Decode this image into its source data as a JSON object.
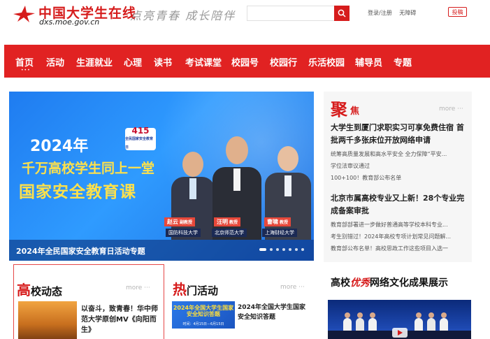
{
  "header": {
    "site_name": "中国大学生在线",
    "domain": "dxs.moe.gov.cn",
    "slogan": "点亮青春 成长陪伴",
    "search_placeholder": "",
    "links": [
      "登录/注册",
      "无障碍"
    ],
    "submit_label": "投稿",
    "icons": [
      "logo-star-icon",
      "search-icon"
    ],
    "brand_color": "#d61c1c"
  },
  "nav": {
    "items": [
      "首页",
      "活动",
      "生涯就业",
      "心理",
      "读书",
      "考试课堂",
      "校园号",
      "校园行",
      "乐活校园",
      "辅导员",
      "专题"
    ],
    "active_index": 0,
    "active_marker": "•••",
    "color": "#e12222"
  },
  "banner": {
    "year": "2024年",
    "line1": "千万高校学生同上一堂",
    "line2": "国家安全教育课",
    "badge_number": "415",
    "badge_sub": "全民国家安全教育日",
    "speakers": [
      {
        "name": "赵云",
        "title": "副教授",
        "university": "国防科技大学"
      },
      {
        "name": "汪明",
        "title": "教授",
        "university": "北京师范大学"
      },
      {
        "name": "曹啸",
        "title": "教授",
        "university": "上海财经大学"
      }
    ],
    "caption": "2024年全民国家安全教育日活动专题",
    "slide_count": 7,
    "active_slide": 0
  },
  "focus": {
    "title_big": "聚",
    "title_small": "焦",
    "more_label": "more ···",
    "headline1": "大学生到厦门求职实习可享免费住宿 首批两千多张床位开放网络申请",
    "items1": [
      "统筹高质量发展和高水平安全 全力保障“平安...",
      "学位法审议通过",
      "100+100！教育部公布名单"
    ],
    "headline2": "北京市属高校专业又上新！28个专业完成备案审批",
    "items2": [
      "教育部部署进一步做好普通高等学校本科专业...",
      "考生别错过！2024年高校专项计划常见问题解...",
      "教育部公布名单！高校思政工作这些项目入选一"
    ]
  },
  "news": {
    "title_big": "高",
    "title_rest": "校动态",
    "more_label": "more ···",
    "item_title": "以奋斗，致青春！华中师范大学原创MV《向阳而生》"
  },
  "hot": {
    "title_big": "热",
    "title_rest": "门活动",
    "more_label": "more ···",
    "thumb_title": "2024年全国大学生国家安全知识答题",
    "thumb_date": "时间：4月15日－6月15日",
    "item_title": "2024年全国大学生国家安全知识答题"
  },
  "culture": {
    "title_a": "高校",
    "title_hl": "优秀",
    "title_b": "网络文化成果展示",
    "icons": [
      "play-icon"
    ]
  }
}
